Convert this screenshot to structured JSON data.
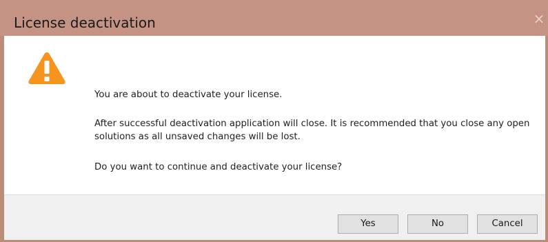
{
  "dialog": {
    "title": "License deactivation",
    "close_glyph": "×",
    "icon": "warning-triangle-icon",
    "messages": {
      "line1": "You are about to deactivate your license.",
      "line2": "After successful deactivation application will close. It is recommended that you close any open solutions as all unsaved changes will be lost.",
      "line3": "Do you want to continue and deactivate your license?"
    },
    "buttons": {
      "yes": "Yes",
      "no": "No",
      "cancel": "Cancel"
    }
  },
  "colors": {
    "titlebar": "#c49383",
    "warning": "#f7941d",
    "footer": "#f0f0f0"
  }
}
